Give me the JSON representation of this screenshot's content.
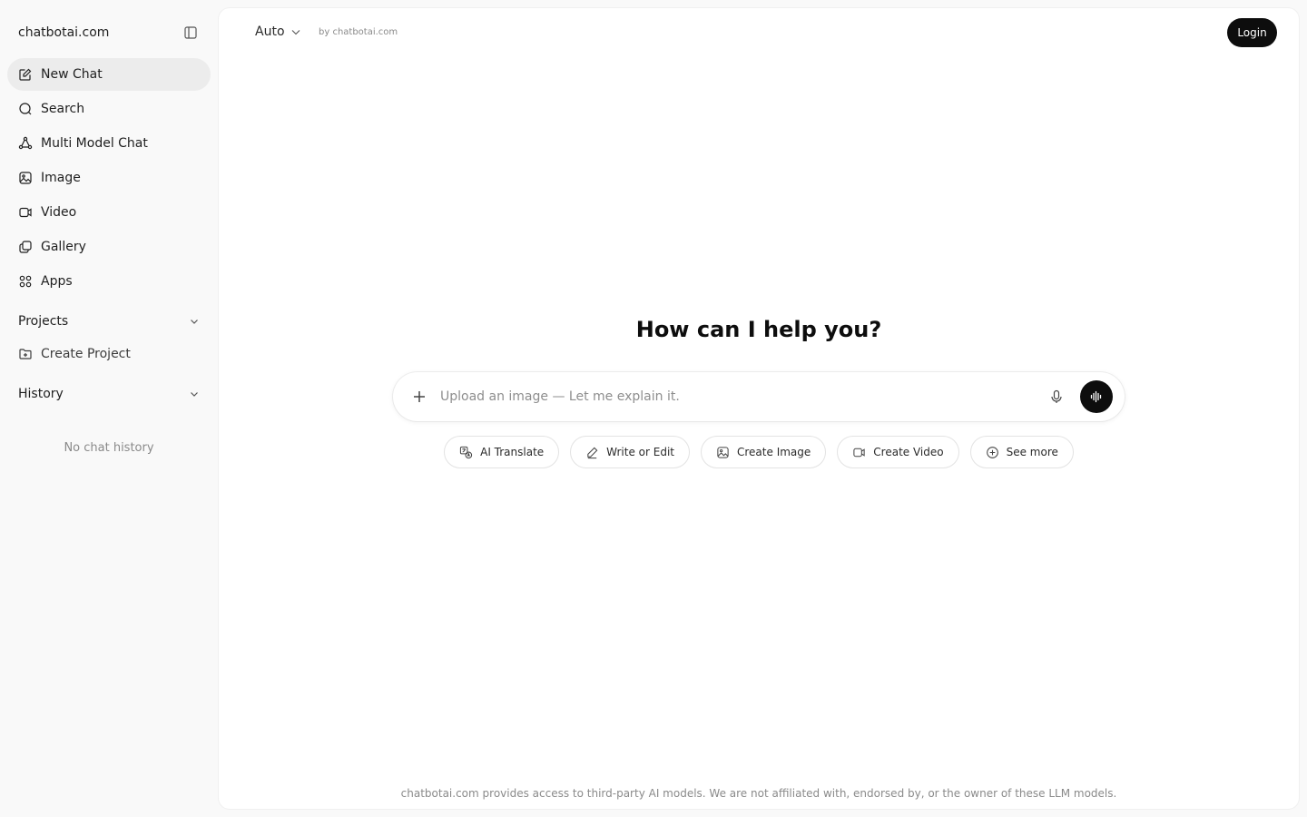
{
  "sidebar": {
    "brand": "chatbotai.com",
    "items": [
      {
        "label": "New Chat",
        "icon": "edit-icon"
      },
      {
        "label": "Search",
        "icon": "search-icon"
      },
      {
        "label": "Multi Model Chat",
        "icon": "multi-model-icon"
      },
      {
        "label": "Image",
        "icon": "image-icon"
      },
      {
        "label": "Video",
        "icon": "video-icon"
      },
      {
        "label": "Gallery",
        "icon": "gallery-icon"
      },
      {
        "label": "Apps",
        "icon": "apps-grid-icon"
      }
    ],
    "projects_label": "Projects",
    "create_project_label": "Create Project",
    "history_label": "History",
    "no_history": "No chat history"
  },
  "header": {
    "model": "Auto",
    "by": "by chatbotai.com",
    "login": "Login"
  },
  "main": {
    "headline": "How can I help you?",
    "composer_placeholder": "Upload an image — Let me explain it.",
    "chips": [
      {
        "label": "AI Translate",
        "icon": "translate-icon"
      },
      {
        "label": "Write or Edit",
        "icon": "pencil-icon"
      },
      {
        "label": "Create Image",
        "icon": "image-icon"
      },
      {
        "label": "Create Video",
        "icon": "video-icon"
      },
      {
        "label": "See more",
        "icon": "plus-circle-icon"
      }
    ],
    "footer": "chatbotai.com provides access to third-party AI models. We are not affiliated with, endorsed by, or the owner of these LLM models."
  },
  "colors": {
    "accent": "#0d0d0d",
    "sidebar_bg": "#f9f9f9",
    "active_item_bg": "#ececec"
  }
}
